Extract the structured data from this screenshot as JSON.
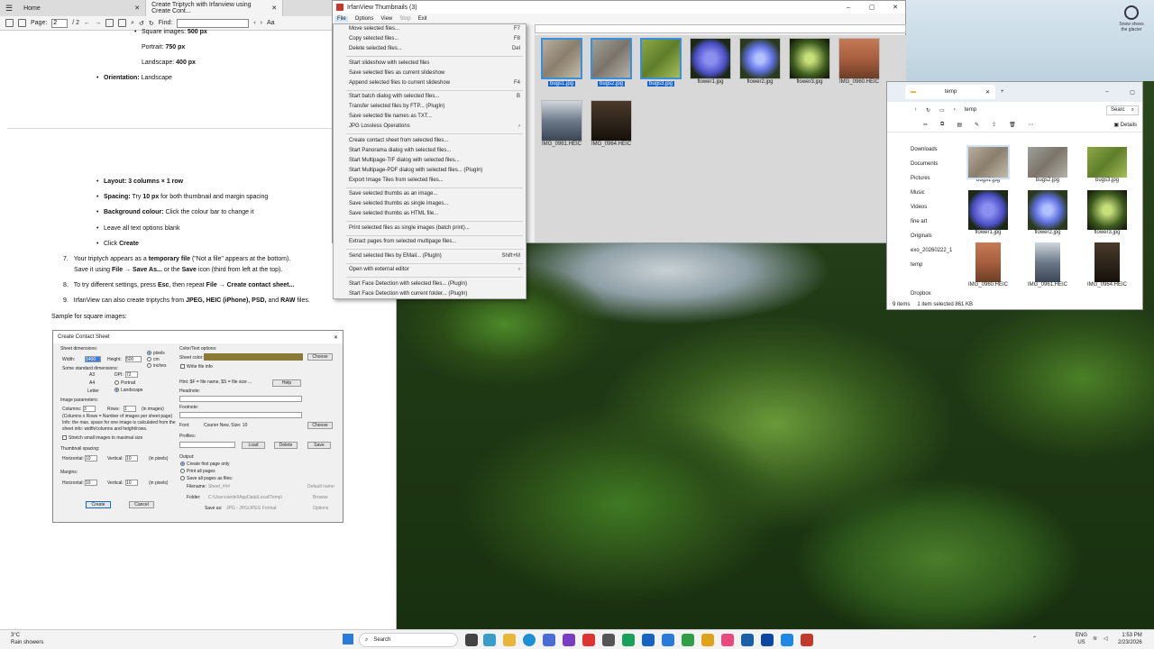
{
  "pdf": {
    "tabs": [
      {
        "label": "Home"
      },
      {
        "label": "Create Triptych with Irfanview using Create Cont..."
      }
    ],
    "toolbar": {
      "page_label": "Page:",
      "page_value": "2",
      "page_total": "/ 2",
      "find_label": "Find:"
    },
    "lines": {
      "square": "Square images: ",
      "square_b": "500 px",
      "portrait": "Portrait: ",
      "portrait_b": "750 px",
      "landscape": "Landscape: ",
      "landscape_b": "400 px",
      "orientation_b": "Orientation:",
      "orientation": " Landscape",
      "layout_b": "Layout: 3 columns × 1 row",
      "spacing": "Spacing: ",
      "spacing_t": "Try ",
      "spacing_b": "10 px",
      "spacing_rest": " for both thumbnail and margin spacing",
      "bg_b": "Background colour:",
      "bg": " Click the colour bar to change it",
      "leave": "Leave all text options blank",
      "click": "Click ",
      "click_b": "Create",
      "step7_num": "7.",
      "step7_a": "Your triptych appears as a ",
      "step7_b": "temporary file",
      "step7_c": " (\"Not a file\" appears at the bottom).",
      "step7_d": "Save it using ",
      "step7_e": "File → Save As...",
      "step7_f": " or the ",
      "step7_g": "Save",
      "step7_h": " icon (third from left at the top).",
      "step8_num": "8.",
      "step8_a": "To try different settings, press ",
      "step8_b": "Esc",
      "step8_c": ", then repeat ",
      "step8_d": "File → Create contact sheet...",
      "step9_num": "9.",
      "step9_a": "IrfanView can also create triptychs from ",
      "step9_b": "JPEG, HEIC (iPhone), PSD,",
      "step9_c": " and ",
      "step9_d": "RAW",
      "step9_e": " files.",
      "sample": "Sample for square images:"
    }
  },
  "contact_sheet": {
    "title": "Create Contact Sheet",
    "sheet_dims": "Sheet dimensions:",
    "width_label": "Width:",
    "width_value": "1400",
    "height_label": "Height:",
    "height_value": "500",
    "pixels": "pixels",
    "cm": "cm",
    "inches": "inches",
    "std_dims": "Some standard dimensions:",
    "a3": "A3",
    "a4": "A4",
    "letter": "Letter",
    "dpi_label": "DPI:",
    "dpi_value": "72",
    "portrait": "Portrait",
    "landscape": "Landscape",
    "image_params": "Image parameters:",
    "columns_label": "Columns:",
    "columns_value": "3",
    "rows_label": "Rows:",
    "rows_value": "1",
    "in_images": "(in images)",
    "formula": "(Columns x Rows = Number of images per sheet page)",
    "info1": "Info: the max. space for one image is calculated from the",
    "info2": "sheet info: width/columns and height/rows.",
    "stretch": "Stretch small images to maximal size",
    "thumb_spacing": "Thumbnail spacing:",
    "horizontal": "Horizontal:",
    "h_value": "10",
    "vertical": "Vertical:",
    "v_value": "10",
    "in_pixels": "(in pixels)",
    "margins": "Margins:",
    "m_h_value": "10",
    "m_v_value": "10",
    "color_text_opts": "Color/Text options:",
    "sheet_color": "Sheet color:",
    "choose": "Choose",
    "write_file_info": "Write file info",
    "hint": "Hint: $F = file name, $S = file size ...",
    "help": "Help",
    "headnote": "Headnote:",
    "footnote": "Footnote:",
    "font_label": "Font:",
    "font_value": "Courier New, Size: 10",
    "profiles": "Profiles:",
    "load": "Load",
    "delete": "Delete",
    "save": "Save",
    "output": "Output:",
    "create_first": "Create first page only",
    "print_all": "Print all pages",
    "save_all": "Save all pages as files:",
    "filename_label": "Filename:",
    "filename_value": "Sheet_###",
    "default_name": "Default name",
    "folder_label": "Folder:",
    "folder_value": "C:\\Users\\wrdel\\AppData\\Local\\Temp\\",
    "browse": "Browse",
    "saveas_label": "Save as:",
    "saveas_value": "JPG - JPG/JPEG Format",
    "options": "Options",
    "create": "Create",
    "cancel": "Cancel",
    "sheet_color_hex": "#8b7a36"
  },
  "irfan": {
    "title": "IrfanView Thumbnails (3)",
    "menus": [
      "File",
      "Options",
      "View",
      "Stop",
      "Exit"
    ],
    "thumbs": [
      {
        "name": "bugs1.jpg",
        "cls": "bug",
        "selected": true
      },
      {
        "name": "bugs2.jpg",
        "cls": "bug2",
        "selected": true
      },
      {
        "name": "bugs3.jpg",
        "cls": "bug3",
        "selected": true
      },
      {
        "name": "flower1.jpg",
        "cls": "flower1",
        "selected": false
      },
      {
        "name": "flower2.jpg",
        "cls": "flower2",
        "selected": false
      },
      {
        "name": "flower3.jpg",
        "cls": "flower3",
        "selected": false
      },
      {
        "name": "IMG_0960.HEIC",
        "cls": "portrait",
        "selected": false
      },
      {
        "name": "IMG_0961.HEIC",
        "cls": "ph61",
        "selected": false
      },
      {
        "name": "IMG_0964.HEIC",
        "cls": "ph64",
        "selected": false
      }
    ]
  },
  "file_menu": {
    "items": [
      {
        "label": "Move selected files...",
        "shortcut": "F7"
      },
      {
        "label": "Copy selected files...",
        "shortcut": "F8"
      },
      {
        "label": "Delete selected files...",
        "shortcut": "Del"
      },
      {
        "label": "Start slideshow with selected files",
        "shortcut": ""
      },
      {
        "label": "Save selected files as current slideshow",
        "shortcut": ""
      },
      {
        "label": "Append selected files to current slideshow",
        "shortcut": "F4"
      },
      {
        "label": "Start batch dialog with selected files...",
        "shortcut": "B"
      },
      {
        "label": "Transfer selected files by FTP... (PlugIn)",
        "shortcut": ""
      },
      {
        "label": "Save selected file names as TXT...",
        "shortcut": ""
      },
      {
        "label": "JPG Lossless Operations",
        "shortcut": "›"
      },
      {
        "label": "Create contact sheet from selected files...",
        "shortcut": ""
      },
      {
        "label": "Start Panorama dialog with selected files...",
        "shortcut": ""
      },
      {
        "label": "Start Multipage-TIF dialog with selected files...",
        "shortcut": ""
      },
      {
        "label": "Start Multipage-PDF dialog with selected files... (PlugIn)",
        "shortcut": ""
      },
      {
        "label": "Export Image Tiles from selected files...",
        "shortcut": ""
      },
      {
        "label": "Save selected thumbs as an image...",
        "shortcut": ""
      },
      {
        "label": "Save selected thumbs as single images...",
        "shortcut": ""
      },
      {
        "label": "Save selected thumbs as HTML file...",
        "shortcut": ""
      },
      {
        "label": "Print selected files as single images (batch print)...",
        "shortcut": ""
      },
      {
        "label": "Extract pages from selected multipage files...",
        "shortcut": ""
      },
      {
        "label": "Send selected files by EMail... (PlugIn)",
        "shortcut": "Shift+M"
      },
      {
        "label": "Open with external editor",
        "shortcut": "›"
      },
      {
        "label": "Start Face Detection with selected files... (PlugIn)",
        "shortcut": ""
      },
      {
        "label": "Start Face Detection with current folder... (PlugIn)",
        "shortcut": ""
      }
    ]
  },
  "explorer": {
    "tab": "temp",
    "path": "temp",
    "search": "Searc",
    "details": "Details",
    "sidebar": [
      {
        "label": "Downloads"
      },
      {
        "label": "Documents"
      },
      {
        "label": "Pictures"
      },
      {
        "label": "Music"
      },
      {
        "label": "Videos"
      },
      {
        "label": "fine art"
      },
      {
        "label": "Originals"
      },
      {
        "label": "exo_20260222_1"
      },
      {
        "label": "temp"
      },
      {
        "label": "Dropbox"
      }
    ],
    "files": [
      {
        "name": "bugs1.jpg",
        "cls": "bug",
        "selected": true
      },
      {
        "name": "bugs2.jpg",
        "cls": "bug2",
        "selected": false
      },
      {
        "name": "bugs3.jpg",
        "cls": "bug3",
        "selected": false
      },
      {
        "name": "flower1.jpg",
        "cls": "flower1",
        "selected": false
      },
      {
        "name": "flower2.jpg",
        "cls": "flower2",
        "selected": false
      },
      {
        "name": "flower3.jpg",
        "cls": "flower3",
        "selected": false
      },
      {
        "name": "IMG_0960.HEIC",
        "cls": "portrait",
        "selected": false
      },
      {
        "name": "IMG_0961.HEIC",
        "cls": "ph61",
        "selected": false
      },
      {
        "name": "IMG_0964.HEIC",
        "cls": "ph64",
        "selected": false
      }
    ],
    "status_items": "9 items",
    "status_selected": "1 item selected  861 KB"
  },
  "desktop": {
    "icon_label_1": "Snow shoes",
    "icon_label_2": "the glacier"
  },
  "taskbar": {
    "weather_temp": "3°C",
    "weather_text": "Rain showers",
    "search": "Search",
    "lang": "ENG",
    "region": "US",
    "time": "1:53 PM",
    "date": "2/23/2026"
  }
}
